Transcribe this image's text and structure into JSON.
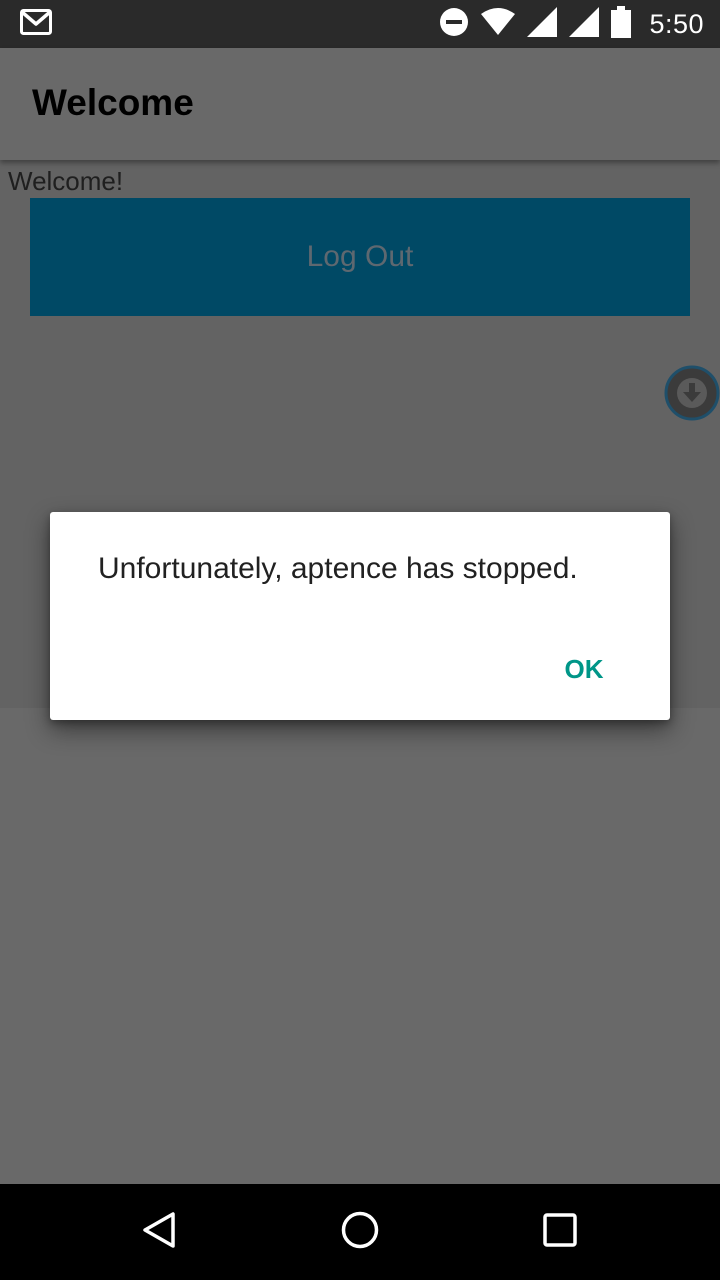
{
  "status_bar": {
    "time": "5:50",
    "icons": [
      "gmail-icon",
      "do-not-disturb-icon",
      "wifi-icon",
      "signal-icon",
      "signal-icon",
      "battery-icon"
    ]
  },
  "app_bar": {
    "title": "Welcome"
  },
  "content": {
    "welcome_text": "Welcome!",
    "logout_label": "Log Out",
    "fab_icon": "download-icon"
  },
  "dialog": {
    "message": "Unfortunately, aptence has stopped.",
    "ok_label": "OK"
  },
  "nav_bar": {
    "back_icon": "back-icon",
    "home_icon": "home-icon",
    "recents_icon": "recents-icon"
  },
  "colors": {
    "scrim": "#686868",
    "status_bar": "#2a2a2a",
    "logout_button": "#004965",
    "dialog_accent": "#009688",
    "nav_bar": "#000000"
  }
}
